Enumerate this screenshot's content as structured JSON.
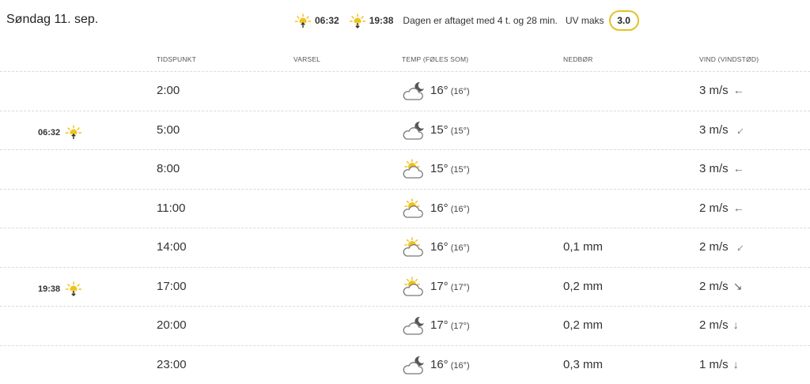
{
  "header": {
    "date": "Søndag 11. sep.",
    "sunrise": "06:32",
    "sunset": "19:38",
    "daylight_text": "Dagen er aftaget med 4 t. og 28 min.",
    "uv_label": "UV maks",
    "uv_value": "3.0"
  },
  "columns": {
    "time": "TIDSPUNKT",
    "forecast": "VARSEL",
    "temp": "TEMP (FØLES SOM)",
    "precip": "NEDBØR",
    "wind": "VIND (VINDSTØD)"
  },
  "rows": [
    {
      "time": "2:00",
      "icon": "cloud-moon-icon",
      "temp": "16°",
      "feels": "(16°)",
      "precip": "",
      "wind": "3 m/s",
      "arrow": "←",
      "arrow_rot": 0,
      "sun_event": "",
      "sun_time": ""
    },
    {
      "time": "5:00",
      "icon": "cloud-moon-icon",
      "temp": "15°",
      "feels": "(15°)",
      "precip": "",
      "wind": "3 m/s",
      "arrow": "←",
      "arrow_rot": -45,
      "sun_event": "sunrise",
      "sun_time": "06:32"
    },
    {
      "time": "8:00",
      "icon": "cloud-sun-icon",
      "temp": "15°",
      "feels": "(15°)",
      "precip": "",
      "wind": "3 m/s",
      "arrow": "←",
      "arrow_rot": 0,
      "sun_event": "",
      "sun_time": ""
    },
    {
      "time": "11:00",
      "icon": "cloud-sun-icon",
      "temp": "16°",
      "feels": "(16°)",
      "precip": "",
      "wind": "2 m/s",
      "arrow": "←",
      "arrow_rot": 0,
      "sun_event": "",
      "sun_time": ""
    },
    {
      "time": "14:00",
      "icon": "cloud-sun-icon",
      "temp": "16°",
      "feels": "(16°)",
      "precip": "0,1 mm",
      "wind": "2 m/s",
      "arrow": "←",
      "arrow_rot": -45,
      "sun_event": "",
      "sun_time": ""
    },
    {
      "time": "17:00",
      "icon": "cloud-sun-icon",
      "temp": "17°",
      "feels": "(17°)",
      "precip": "0,2 mm",
      "wind": "2 m/s",
      "arrow": "↘",
      "arrow_rot": 0,
      "sun_event": "sunset",
      "sun_time": "19:38"
    },
    {
      "time": "20:00",
      "icon": "cloud-moon-icon",
      "temp": "17°",
      "feels": "(17°)",
      "precip": "0,2 mm",
      "wind": "2 m/s",
      "arrow": "↓",
      "arrow_rot": 0,
      "sun_event": "",
      "sun_time": ""
    },
    {
      "time": "23:00",
      "icon": "cloud-moon-icon",
      "temp": "16°",
      "feels": "(16°)",
      "precip": "0,3 mm",
      "wind": "1 m/s",
      "arrow": "↓",
      "arrow_rot": 0,
      "sun_event": "",
      "sun_time": ""
    }
  ],
  "colors": {
    "sun": "#f2c21b",
    "uv_border": "#e2c12a",
    "icon_outline": "#777777"
  }
}
